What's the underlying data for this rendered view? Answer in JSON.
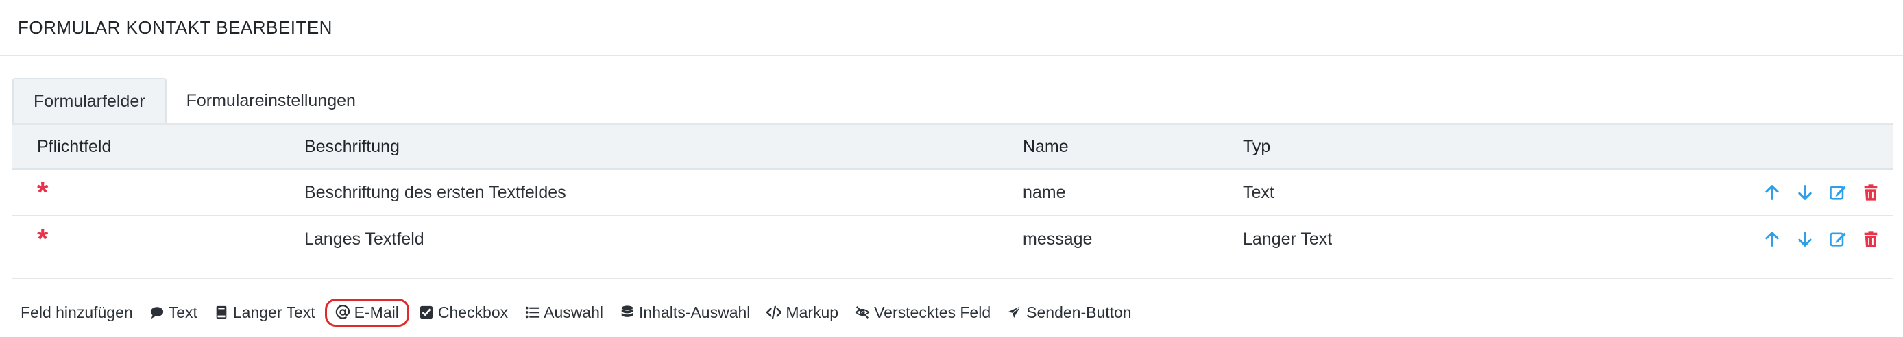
{
  "header": {
    "title": "FORMULAR KONTAKT BEARBEITEN"
  },
  "tabs": [
    {
      "label": "Formularfelder",
      "active": true
    },
    {
      "label": "Formulareinstellungen",
      "active": false
    }
  ],
  "table": {
    "columns": [
      "Pflichtfeld",
      "Beschriftung",
      "Name",
      "Typ"
    ],
    "rows": [
      {
        "required": true,
        "label": "Beschriftung des ersten Textfeldes",
        "name": "name",
        "type": "Text"
      },
      {
        "required": true,
        "label": "Langes Textfeld",
        "name": "message",
        "type": "Langer Text"
      }
    ],
    "required_symbol": "*"
  },
  "add_field": {
    "label": "Feld hinzufügen",
    "buttons": [
      {
        "label": "Text",
        "icon": "speech-bubble-icon"
      },
      {
        "label": "Langer Text",
        "icon": "book-icon"
      },
      {
        "label": "E-Mail",
        "icon": "at-icon",
        "highlighted": true
      },
      {
        "label": "Checkbox",
        "icon": "checkbox-icon"
      },
      {
        "label": "Auswahl",
        "icon": "list-icon"
      },
      {
        "label": "Inhalts-Auswahl",
        "icon": "database-icon"
      },
      {
        "label": "Markup",
        "icon": "code-icon"
      },
      {
        "label": "Verstecktes Feld",
        "icon": "eye-slash-icon"
      },
      {
        "label": "Senden-Button",
        "icon": "paper-plane-icon"
      }
    ]
  },
  "colors": {
    "accent_blue": "#2f9fe8",
    "delete_red": "#e8334a",
    "required_red": "#e8334a",
    "highlight_border": "#e02a2a"
  }
}
